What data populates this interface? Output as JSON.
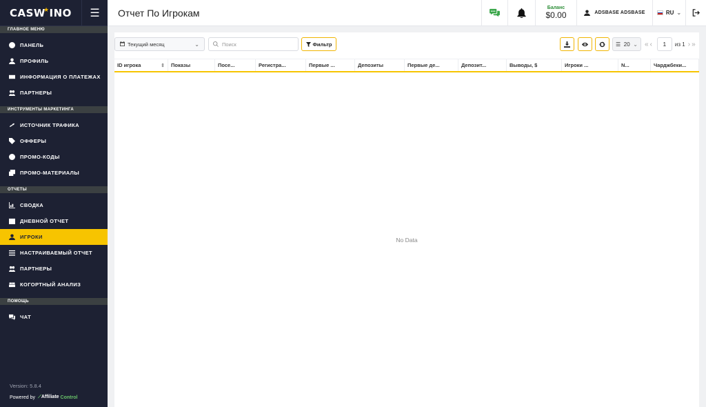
{
  "sidebar": {
    "logo": {
      "pre": "CAS",
      "w": "W",
      "post": "INO"
    },
    "sections": [
      {
        "header": "ГЛАВНОЕ МЕНЮ",
        "items": [
          {
            "label": "ПАНЕЛЬ",
            "icon": "dashboard-icon"
          },
          {
            "label": "ПРОФИЛЬ",
            "icon": "user-icon"
          },
          {
            "label": "ИНФОРМАЦИЯ О ПЛАТЕЖАХ",
            "icon": "money-icon"
          },
          {
            "label": "ПАРТНЕРЫ",
            "icon": "users-icon"
          }
        ]
      },
      {
        "header": "ИНСТРУМЕНТЫ МАРКЕТИНГА",
        "items": [
          {
            "label": "ИСТОЧНИК ТРАФИКА",
            "icon": "link-icon"
          },
          {
            "label": "ОФФЕРЫ",
            "icon": "tag-icon"
          },
          {
            "label": "ПРОМО-КОДЫ",
            "icon": "badge-icon"
          },
          {
            "label": "ПРОМО-МАТЕРИАЛЫ",
            "icon": "images-icon"
          }
        ]
      },
      {
        "header": "ОТЧЕТЫ",
        "items": [
          {
            "label": "СВОДКА",
            "icon": "chart-icon"
          },
          {
            "label": "ДНЕВНОЙ ОТЧЕТ",
            "icon": "calendar-icon"
          },
          {
            "label": "ИГРОКИ",
            "icon": "player-icon",
            "active": true
          },
          {
            "label": "НАСТРАИВАЕМЫЙ ОТЧЕТ",
            "icon": "sliders-icon"
          },
          {
            "label": "ПАРТНЕРЫ",
            "icon": "users-icon"
          },
          {
            "label": "КОГОРТНЫЙ АНАЛИЗ",
            "icon": "group-icon"
          }
        ]
      },
      {
        "header": "ПОМОЩЬ",
        "items": [
          {
            "label": "ЧАТ",
            "icon": "chat-icon"
          }
        ]
      }
    ],
    "version": "Version: 5.8.4",
    "powered_by": "Powered by",
    "powered_brand": "Affiliate",
    "powered_brand2": "Control"
  },
  "header": {
    "title": "Отчет По Игрокам",
    "balance_label": "Баланс",
    "balance_amount": "$0.00",
    "username": "ADSBASE ADSBASE",
    "language": "RU"
  },
  "toolbar": {
    "period": "Текущий месяц",
    "search_placeholder": "Поиск",
    "filter_label": "Фильтр",
    "per_page": "20",
    "page": "1",
    "of_pages": "из 1"
  },
  "table": {
    "columns": [
      "ID игрока",
      "Показы",
      "Посе...",
      "Регистра...",
      "Первые ...",
      "Депозиты",
      "Первые де...",
      "Депозит...",
      "Выводы, $",
      "Игроки ...",
      "N...",
      "Чарджбеки..."
    ],
    "empty_text": "No Data"
  },
  "colors": {
    "sidebar_bg": "#1d2133",
    "accent": "#f7c400",
    "balance_label": "#2f8f3a"
  }
}
